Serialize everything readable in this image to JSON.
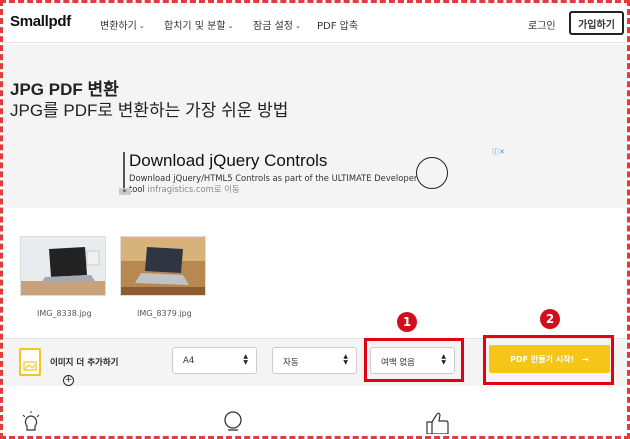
{
  "header": {
    "logo": "Smallpdf",
    "nav": [
      {
        "label": "변환하기",
        "caret": "⌄"
      },
      {
        "label": "합치기 및 분할",
        "caret": "⌄"
      },
      {
        "label": "잠금 설정",
        "caret": "⌄"
      },
      {
        "label": "PDF 압축",
        "caret": ""
      }
    ],
    "login": "로그인",
    "signup": "가입하기"
  },
  "hero": {
    "title": "JPG PDF 변환",
    "subtitle": "JPG를 PDF로 변환하는 가장 쉬운 방법"
  },
  "ad": {
    "title": "Download jQuery Controls",
    "description": "Download jQuery/HTML5 Controls as part of the ULTIMATE Developer tool",
    "url": "infragistics.com로 이동",
    "choice": "ⓘ✕"
  },
  "files": [
    {
      "name": "IMG_8338.jpg"
    },
    {
      "name": "IMG_8379.jpg"
    }
  ],
  "toolbar": {
    "add_more": "이미지 더 추가하기",
    "page_size": "A4",
    "orientation": "자동",
    "margin": "여백 없음",
    "submit": "PDF 만들기 시작!",
    "submit_arrow": "→"
  },
  "annotations": [
    "1",
    "2"
  ],
  "colors": {
    "accent": "#f5c518",
    "highlight": "#e40012",
    "hero_bg": "#f4f4f4"
  }
}
